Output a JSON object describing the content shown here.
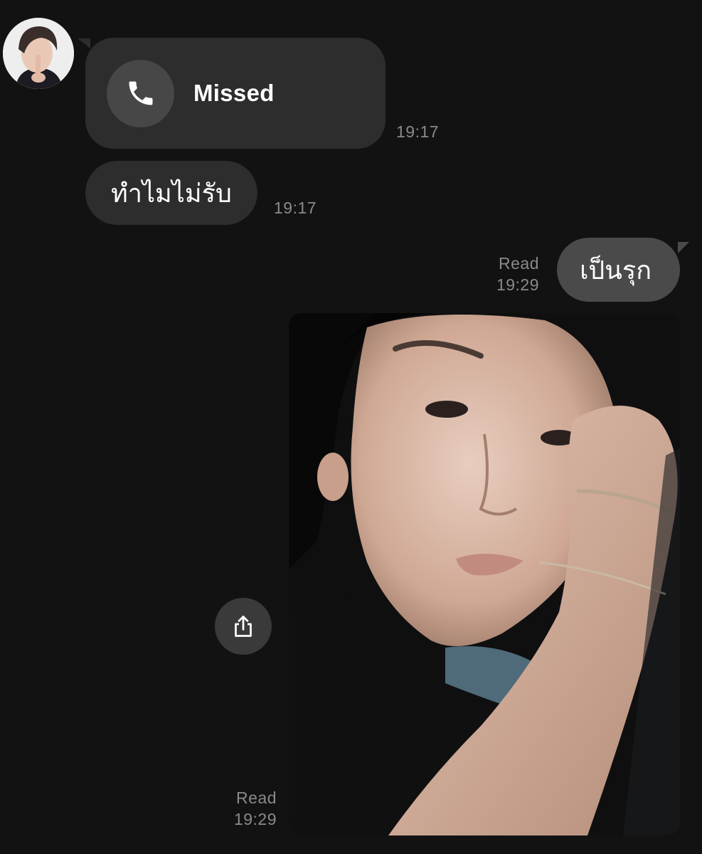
{
  "conversation": {
    "contact": {
      "avatar_icon": "avatar-photo"
    },
    "messages": [
      {
        "direction": "incoming",
        "kind": "call",
        "call_icon": "phone-icon",
        "label": "Missed",
        "time": "19:17"
      },
      {
        "direction": "incoming",
        "kind": "text",
        "text": "ทำไมไม่รับ",
        "time": "19:17"
      },
      {
        "direction": "outgoing",
        "kind": "text",
        "text": "เป็นรุก",
        "read_label": "Read",
        "time": "19:29"
      },
      {
        "direction": "outgoing",
        "kind": "photo",
        "share_icon": "share-icon",
        "read_label": "Read",
        "time": "19:29"
      }
    ]
  },
  "colors": {
    "background": "#121212",
    "incoming_bubble": "#2d2d2d",
    "outgoing_bubble": "#4a4a4a",
    "meta_text": "#8a8a8a"
  }
}
